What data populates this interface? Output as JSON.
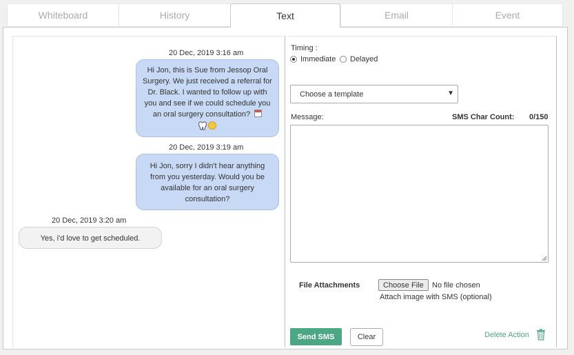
{
  "tabs": [
    {
      "label": "Whiteboard"
    },
    {
      "label": "History"
    },
    {
      "label": "Text"
    },
    {
      "label": "Email"
    },
    {
      "label": "Event"
    }
  ],
  "active_tab": "Text",
  "conversation": {
    "messages": [
      {
        "timestamp": "20 Dec, 2019 3:16 am",
        "direction": "outgoing",
        "text": "Hi Jon, this is Sue from Jessop Oral Surgery. We just received a referral for Dr. Black. I wanted to follow up with you and see if we could schedule you an oral surgery consultation?",
        "icons": [
          "calendar-icon",
          "tooth-icon",
          "smile-icon"
        ]
      },
      {
        "timestamp": "20 Dec, 2019 3:19 am",
        "direction": "outgoing",
        "text": "Hi Jon, sorry I didn't hear anything from you yesterday. Would you be available for an oral surgery consultation?"
      },
      {
        "timestamp": "20 Dec, 2019 3:20 am",
        "direction": "incoming",
        "text": "Yes, i'd love to get scheduled."
      }
    ]
  },
  "form": {
    "timing_label": "Timing :",
    "timing_options": [
      {
        "label": "Immediate",
        "checked": true
      },
      {
        "label": "Delayed",
        "checked": false
      }
    ],
    "template_select": {
      "selected": "Choose a template"
    },
    "message_label": "Message:",
    "char_count_label": "SMS Char Count:",
    "char_count_value": "0/150",
    "message_value": "",
    "file_attachments_label": "File Attachments",
    "choose_file_label": "Choose File",
    "no_file_text": "No file chosen",
    "attach_hint": "Attach image with SMS (optional)",
    "send_label": "Send SMS",
    "clear_label": "Clear",
    "delete_label": "Delete Action"
  },
  "colors": {
    "accent": "#4ca785",
    "outgoing_bubble": "#c8d9f5",
    "incoming_bubble": "#f2f2f2"
  }
}
